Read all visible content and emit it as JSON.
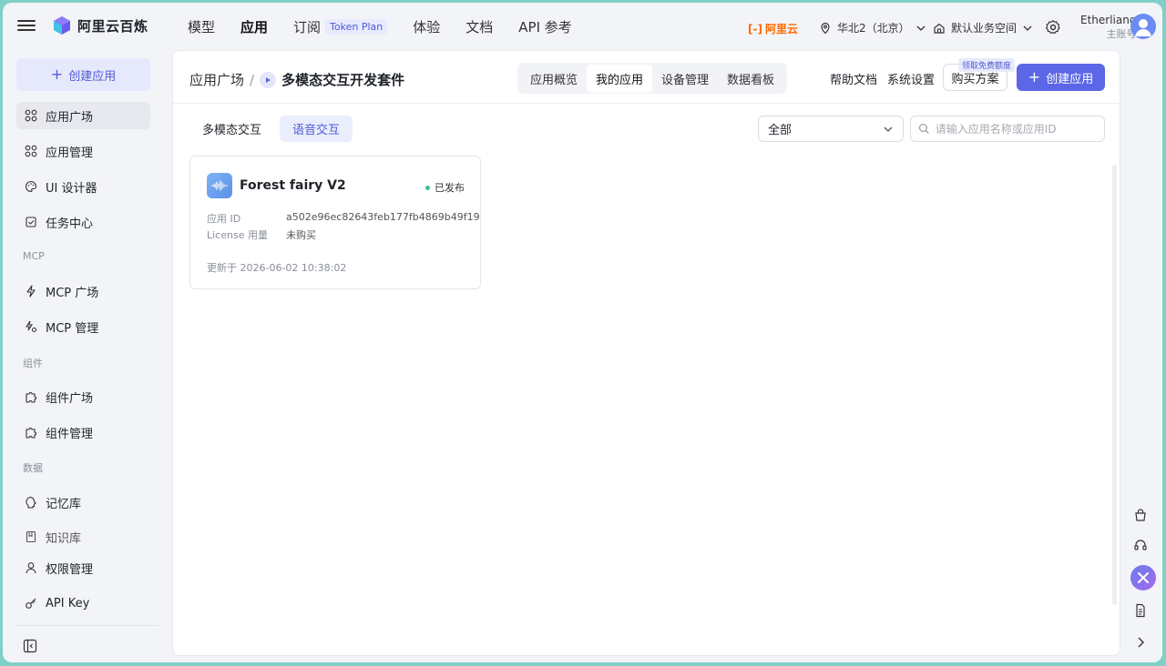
{
  "topbar": {
    "logo_text": "阿里云百炼",
    "nav": [
      {
        "label": "模型"
      },
      {
        "label": "应用"
      },
      {
        "label": "订阅",
        "badge": "Token Plan"
      },
      {
        "label": "体验"
      },
      {
        "label": "文档"
      },
      {
        "label": "API 参考"
      }
    ],
    "aliyun_label": "阿里云",
    "region": "华北2（北京）",
    "workspace": "默认业务空间",
    "user_name": "Etherliang",
    "user_role": "主账号"
  },
  "sidebar": {
    "create_label": "创建应用",
    "items": [
      {
        "label": "应用广场",
        "icon": "grid-icon"
      },
      {
        "label": "应用管理",
        "icon": "grid-icon"
      },
      {
        "label": "UI 设计器",
        "icon": "palette-icon"
      },
      {
        "label": "任务中心",
        "icon": "task-icon"
      },
      {
        "label": "MCP 广场",
        "icon": "lightning-icon"
      },
      {
        "label": "MCP 管理",
        "icon": "mcp-manage-icon"
      },
      {
        "label": "组件广场",
        "icon": "puzzle-icon"
      },
      {
        "label": "组件管理",
        "icon": "puzzle-icon"
      },
      {
        "label": "记忆库",
        "icon": "brain-icon"
      },
      {
        "label": "知识库",
        "icon": "book-icon"
      },
      {
        "label": "权限管理",
        "icon": "user-icon"
      },
      {
        "label": "API Key",
        "icon": "key-icon"
      }
    ],
    "groups": [
      "MCP",
      "组件",
      "数据"
    ]
  },
  "main": {
    "breadcrumb": {
      "parent": "应用广场",
      "separator": "/",
      "current": "多模态交互开发套件"
    },
    "segments": [
      "应用概览",
      "我的应用",
      "设备管理",
      "数据看板"
    ],
    "help_label": "帮助文档",
    "settings_label": "系统设置",
    "buy_label": "购买方案",
    "promo_label": "领取免费额度",
    "create_label": "创建应用",
    "subtabs": [
      "多模态交互",
      "语音交互"
    ],
    "filter_value": "全部",
    "search_placeholder": "请输入应用名称或应用ID",
    "card": {
      "title": "Forest fairy V2",
      "status": "已发布",
      "id_label": "应用 ID",
      "id_value": "a502e96ec82643feb177fb4869b49f19",
      "license_label": "License 用量",
      "license_value": "未购买",
      "updated": "更新于 2026-06-02 10:38:02"
    }
  },
  "colors": {
    "accent": "#5b67e6",
    "status_ok": "#3cbf8a",
    "brand_orange": "#ff6a00"
  }
}
